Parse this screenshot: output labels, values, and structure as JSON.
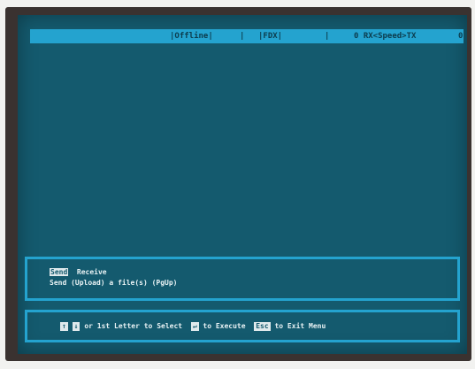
{
  "status": {
    "mode": "|Offline|",
    "sep1": "|",
    "protocol": "|FDX|",
    "sep2": "|",
    "speed": "0 RX<Speed>TX",
    "count": "0"
  },
  "menu": {
    "items": [
      "Send",
      "Receive"
    ],
    "description": "Send (Upload) a file(s) (PgUp)"
  },
  "help": {
    "up_key": "↑",
    "down_key": "↓",
    "select_text": "or 1st Letter to Select",
    "enter_key": "↵",
    "execute_text": "to Execute",
    "esc_key": "Esc",
    "exit_text": "to Exit Menu"
  },
  "colors": {
    "screen_bg": "#145a6e",
    "accent": "#24a3cf",
    "text": "#e8f2f4"
  }
}
